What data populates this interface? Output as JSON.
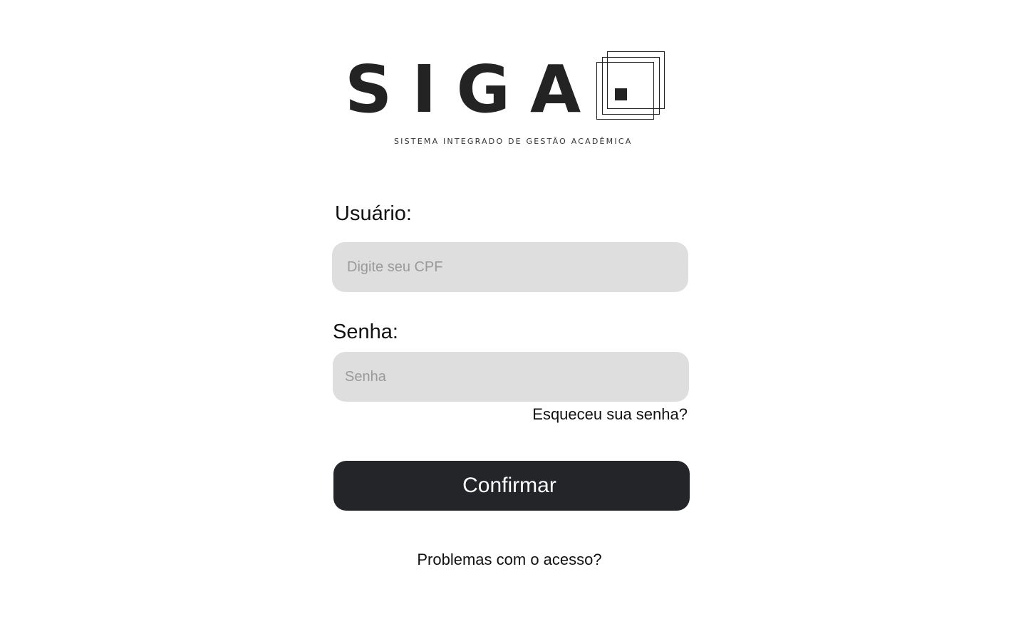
{
  "logo": {
    "wordmark": "SIGA",
    "subtitle": "SISTEMA INTEGRADO DE GESTÃO ACADÊMICA",
    "mark_icon": "nested-squares-icon"
  },
  "form": {
    "user_label": "Usuário:",
    "user_placeholder": "Digite seu CPF",
    "user_value": "",
    "password_label": "Senha:",
    "password_placeholder": "Senha",
    "password_value": "",
    "forgot_link": "Esqueceu sua senha?",
    "confirm_label": "Confirmar",
    "problems_link": "Problemas com o acesso?"
  },
  "colors": {
    "background": "#ffffff",
    "input_bg": "#dedede",
    "button_bg": "#232529",
    "button_text": "#ffffff",
    "logo": "#232323"
  }
}
